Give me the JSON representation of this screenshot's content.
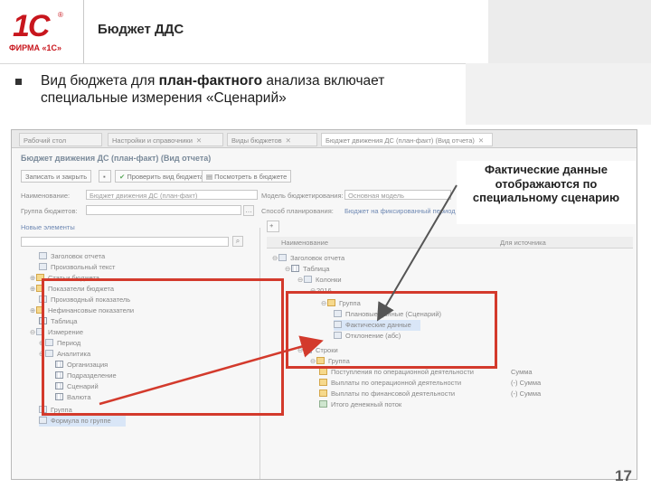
{
  "slide": {
    "logo_text": "1С",
    "logo_reg": "®",
    "logo_company": "ФИРМА «1С»",
    "title": "Бюджет ДДС",
    "bullet_pre": "Вид бюджета для ",
    "bullet_bold": "план-фактного",
    "bullet_post": " анализа включает специальные измерения «Сценарий»",
    "callout": "Фактические данные отображаются по специальному сценарию",
    "page_number": "17"
  },
  "app": {
    "tabs": [
      {
        "label": "Рабочий стол"
      },
      {
        "label": "Настройки и справочники"
      },
      {
        "label": "Виды бюджетов"
      },
      {
        "label": "Бюджет движения ДС (план-факт) (Вид отчета)"
      }
    ],
    "form_title": "Бюджет движения ДС (план-факт) (Вид отчета)",
    "toolbar": {
      "save_close": "Записать и закрыть",
      "check": "Проверить вид бюджета",
      "structure": "Посмотреть в бюджете"
    },
    "fields": {
      "name_label": "Наименование:",
      "name_value": "Бюджет движения ДС (план-факт)",
      "model_label": "Модель бюджетирования:",
      "model_value": "Основная модель",
      "group_label": "Группа бюджетов:",
      "method_label": "Способ планирования:",
      "method_link": "Бюджет на фиксированный период",
      "new_elements": "Новые элементы"
    },
    "right_header": {
      "name": "Наименование",
      "source": "Для источника"
    },
    "left_items": [
      {
        "label": "Заголовок отчета"
      },
      {
        "label": "Произвольный текст"
      },
      {
        "label": "Статьи бюджета"
      },
      {
        "label": "Показатели бюджета"
      },
      {
        "label": "Производный показатель"
      },
      {
        "label": "Нефинансовые показатели"
      },
      {
        "label": "Таблица"
      },
      {
        "label": "Измерение"
      },
      {
        "label": "Период"
      },
      {
        "label": "Аналитика"
      },
      {
        "label": "Организация"
      },
      {
        "label": "Подразделение"
      },
      {
        "label": "Сценарий"
      },
      {
        "label": "Валюта"
      },
      {
        "label": "Группа"
      },
      {
        "label": "Формула по группе"
      }
    ],
    "right_items": [
      {
        "label": "Заголовок отчета",
        "col2": ""
      },
      {
        "label": "Таблица",
        "col2": ""
      },
      {
        "label": "Колонки",
        "col2": ""
      },
      {
        "label": "2016",
        "col2": ""
      },
      {
        "label": "Группа",
        "col2": ""
      },
      {
        "label": "Плановые данные (Сценарий)",
        "col2": ""
      },
      {
        "label": "Фактические данные",
        "col2": ""
      },
      {
        "label": "Отклонение (абс)",
        "col2": ""
      },
      {
        "label": "Строки",
        "col2": ""
      },
      {
        "label": "Группа",
        "col2": ""
      },
      {
        "label": "Поступления по операционной деятельности",
        "col2": "Сумма"
      },
      {
        "label": "Выплаты по операционной деятельности",
        "col2": "(-) Сумма"
      },
      {
        "label": "Выплаты по финансовой деятельности",
        "col2": "(-) Сумма"
      },
      {
        "label": "Итого денежный поток",
        "col2": ""
      }
    ]
  }
}
